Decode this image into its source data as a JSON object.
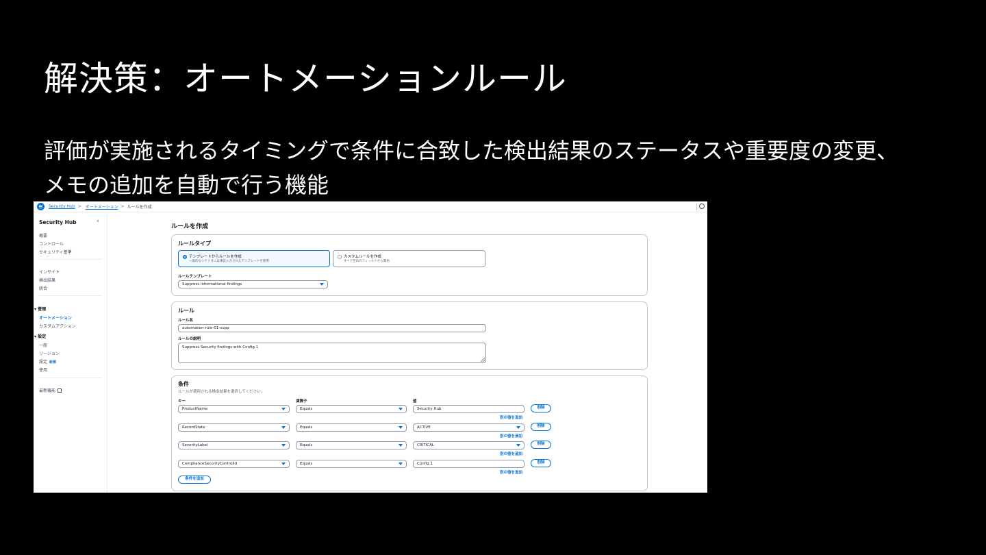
{
  "slide": {
    "title": "解決策：オートメーションルール",
    "description_line1": "評価が実施されるタイミングで条件に合致した検出結果のステータスや重要度の変更、",
    "description_line2": "メモの追加を自動で行う機能"
  },
  "breadcrumb": {
    "items": [
      "Security Hub",
      "オートメーション",
      "ルールを作成"
    ],
    "separator": ">"
  },
  "sidebar": {
    "title": "Security Hub",
    "collapse_icon": "chevron-left-icon",
    "group1": [
      "概要",
      "コントロール",
      "セキュリティ基準"
    ],
    "group2": [
      "インサイト",
      "検出結果",
      "統合"
    ],
    "manage_header": "管理",
    "manage_items": [
      "オートメーション",
      "カスタムアクション"
    ],
    "settings_header": "設定",
    "settings_items": [
      "一般",
      "リージョン",
      "設定",
      "使用"
    ],
    "new_badge": "新規",
    "whats_new": "最新機能"
  },
  "page_title": "ルールを作成",
  "rule_type": {
    "heading": "ルールタイプ",
    "option_template_label": "テンプレートからルールを作成",
    "option_template_desc": "一般的なシナリオには事前入力されたテンプレートを使用",
    "option_custom_label": "カスタムルールを作成",
    "option_custom_desc": "すべて空白のフィールドから開始",
    "selected": "template",
    "template_label": "ルールテンプレート",
    "template_value": "Suppress informational findings"
  },
  "rule": {
    "heading": "ルール",
    "name_label": "ルール名",
    "name_value": "automation-rule-01-supp",
    "desc_label": "ルールの説明",
    "desc_value": "Suppress Security findings with Config.1"
  },
  "conditions": {
    "heading": "条件",
    "subtitle": "ルールが適用される検出結果を選択してください。",
    "col_key": "キー",
    "col_operator": "演算子",
    "col_value": "値",
    "remove_label": "削除",
    "add_value_label": "別の値を追加",
    "add_condition_label": "条件を追加",
    "rows": [
      {
        "key": "ProductName",
        "operator": "Equals",
        "value": "Security Hub"
      },
      {
        "key": "RecordState",
        "operator": "Equals",
        "value": "ACTIVE"
      },
      {
        "key": "SeverityLabel",
        "operator": "Equals",
        "value": "CRITICAL"
      },
      {
        "key": "ComplianceSecurityControlId",
        "operator": "Equals",
        "value": "Config.1"
      }
    ]
  },
  "colors": {
    "accent": "#0972d3",
    "background": "#000000",
    "panel_border": "#c6c6cd"
  }
}
